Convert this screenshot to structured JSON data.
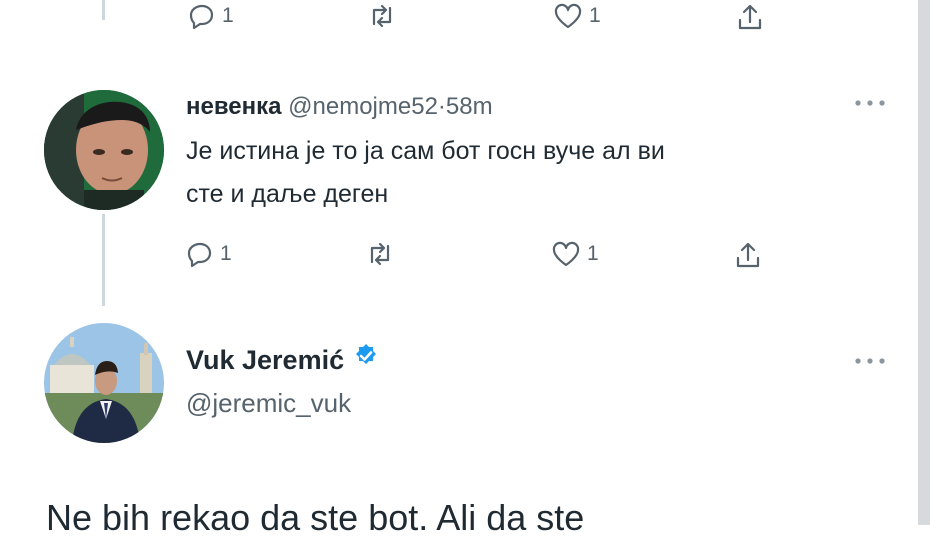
{
  "tweet_top": {
    "reply_count": "1",
    "like_count": "1"
  },
  "tweet_nevenka": {
    "name": "невенка",
    "handle": "@nemojme52",
    "sep": "·",
    "time": "58m",
    "text_line1": "Је истина је то ја сам бот госн вуче ал ви",
    "text_line2": "сте и даље деген",
    "reply_count": "1",
    "like_count": "1"
  },
  "tweet_vuk": {
    "name": "Vuk Jeremić",
    "handle": "@jeremic_vuk",
    "text": "Ne bih rekao da ste bot. Ali da ste"
  },
  "icons": {
    "reply": "reply-icon",
    "retweet": "retweet-icon",
    "like": "heart-icon",
    "share": "share-icon",
    "more": "more-icon",
    "verified": "verified-badge-icon"
  },
  "colors": {
    "text": "#1f2a33",
    "muted": "#57636c",
    "verified": "#1d9bf0",
    "thread_line": "#cfd6dc"
  }
}
